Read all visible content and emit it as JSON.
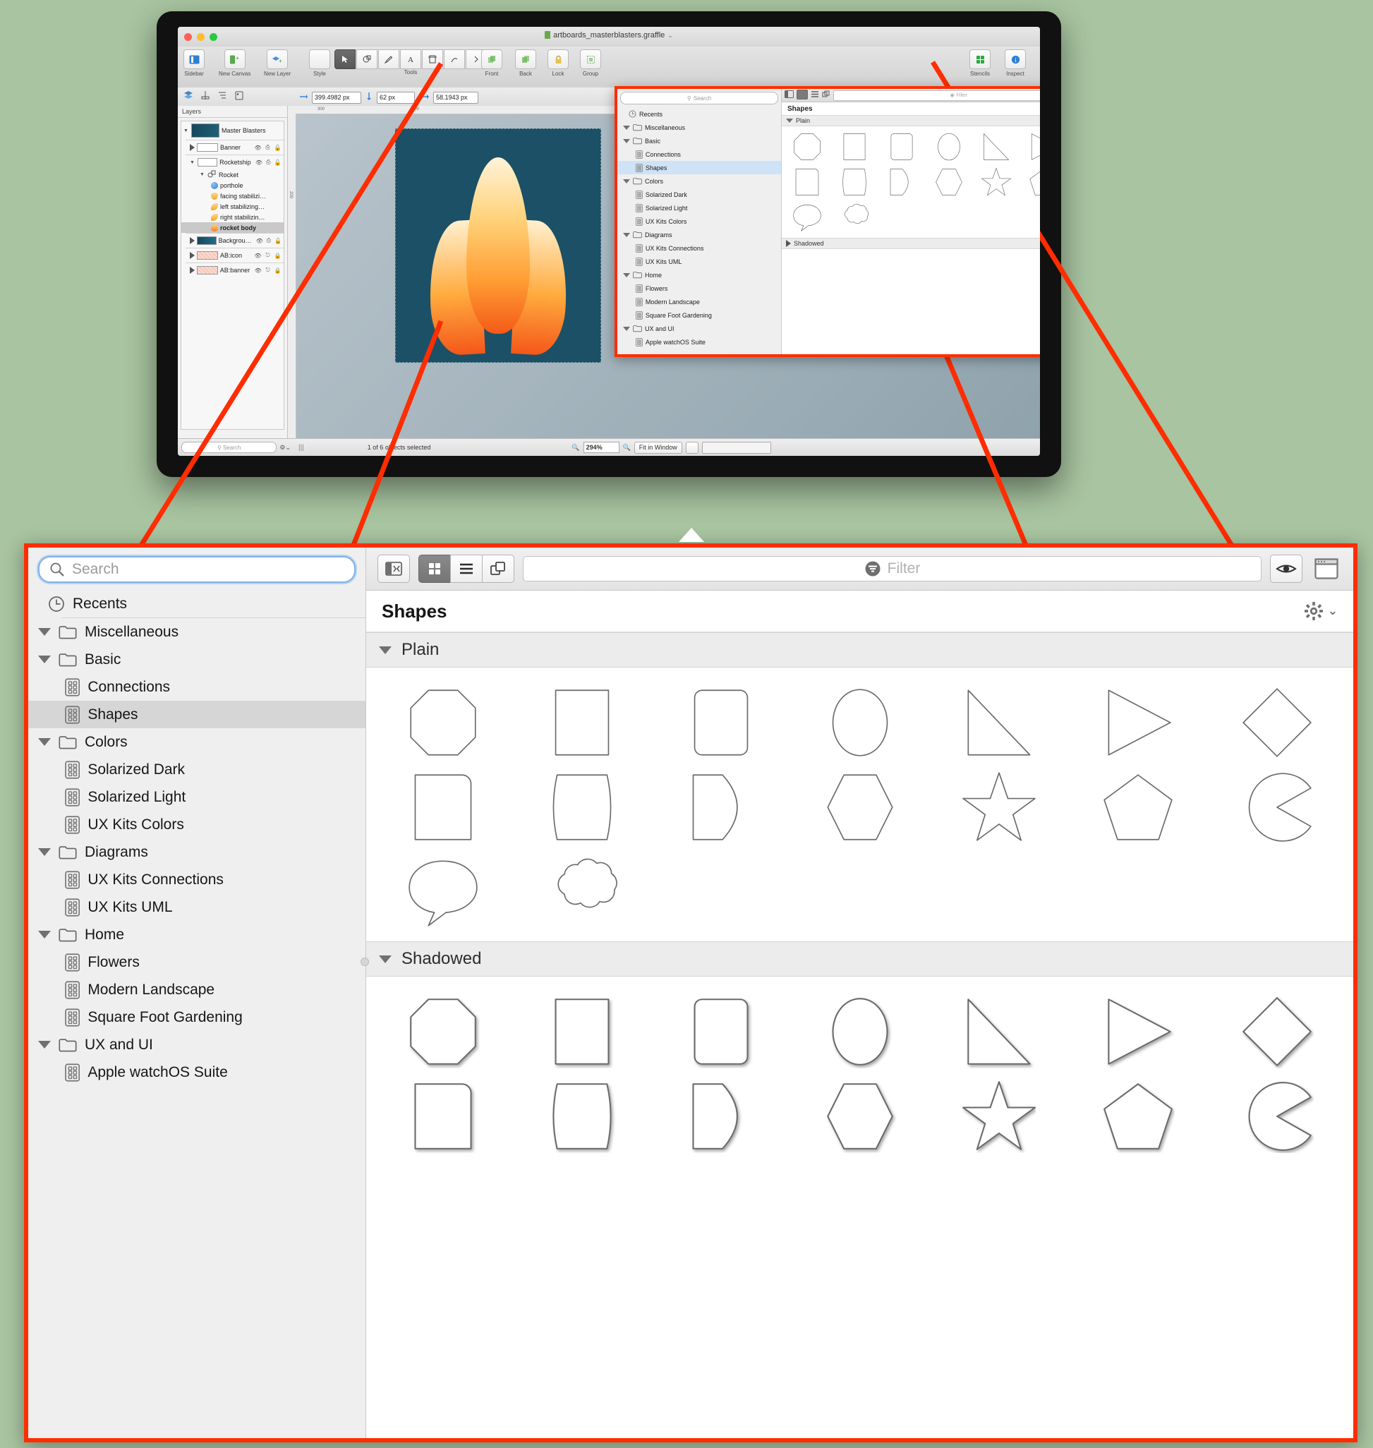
{
  "window": {
    "title": "artboards_masterblasters.graffle",
    "doc_icon": "document-icon",
    "caret": "⌄"
  },
  "toolbar": {
    "groups": [
      {
        "label": "Sidebar",
        "icon": "sidebar-icon"
      },
      {
        "label": "New Canvas",
        "icon": "new-canvas-icon"
      },
      {
        "label": "New Layer",
        "icon": "new-layer-icon"
      },
      {
        "label": "Style",
        "icon": "style-icon"
      },
      {
        "label": "Tools",
        "icon": "tools-icon"
      }
    ],
    "right_labels": [
      "Front",
      "Back",
      "Lock",
      "Group"
    ],
    "stencils_label": "Stencils",
    "inspect_label": "Inspect"
  },
  "geometry_bar": {
    "x_value": "399.4982 px",
    "y_value": "62 px",
    "w_value": "58.1943 px"
  },
  "layers": {
    "header": "Layers",
    "rows": [
      {
        "label": "Master Blasters",
        "type": "canvas",
        "indent": 0,
        "disclosure": "down",
        "thumb": "canvas-thumb"
      },
      {
        "label": "Banner",
        "type": "layer",
        "indent": 1,
        "disclosure": "right",
        "eye": "◉",
        "print": "⎙",
        "lock": "⚿"
      },
      {
        "label": "Rocketship",
        "type": "layer",
        "indent": 1,
        "disclosure": "down",
        "eye": "◉",
        "print": "⎙",
        "lock": "⚿"
      },
      {
        "label": "Rocket",
        "type": "group",
        "indent": 2,
        "disclosure": "down"
      },
      {
        "label": "porthole",
        "type": "object",
        "indent": 3,
        "color": "#3f8fd8"
      },
      {
        "label": "facing stabilizi…",
        "type": "object",
        "indent": 3,
        "color": "#f5b33c"
      },
      {
        "label": "left stabilizing…",
        "type": "object",
        "indent": 3,
        "color": "#f5a83c"
      },
      {
        "label": "right stabilizin…",
        "type": "object",
        "indent": 3,
        "color": "#f5a83c"
      },
      {
        "label": "rocket body",
        "type": "object",
        "indent": 3,
        "color": "#f79a2e",
        "selected": true
      },
      {
        "label": "Backgrou…",
        "type": "layer",
        "indent": 1,
        "disclosure": "right",
        "eye": "◉",
        "print": "⎙",
        "lock": "⚿"
      },
      {
        "label": "AB:icon",
        "type": "layer",
        "indent": 1,
        "disclosure": "right",
        "eye": "◉",
        "print": "⌧",
        "lock": "🔒"
      },
      {
        "label": "AB:banner",
        "type": "layer",
        "indent": 1,
        "disclosure": "right",
        "eye": "◉",
        "print": "⌧",
        "lock": "🔒"
      }
    ],
    "footer_search_placeholder": "Search",
    "gear_icon": "gear-icon"
  },
  "status_bar": {
    "selection": "1 of 6 objects selected",
    "zoom_value": "294%",
    "fit_label": "Fit in Window",
    "zoom_out_icon": "zoom-out-icon",
    "zoom_in_icon": "zoom-in-icon"
  },
  "ruler": {
    "marks": [
      "300",
      "400",
      "200"
    ]
  },
  "stencil_browser": {
    "search_placeholder": "Search",
    "search_icon": "search-icon",
    "filter_placeholder": "Filter",
    "filter_icon": "filter-icon",
    "sidebar_toggle_icon": "sidebar-toggle-icon",
    "grid_view_icon": "grid-view-icon",
    "list_view_icon": "list-view-icon",
    "stack_view_icon": "stack-view-icon",
    "preview_icon": "eye-icon",
    "window_icon": "window-panel-icon",
    "gear_icon": "gear-icon",
    "gear_caret": "⌄",
    "title": "Shapes",
    "sidebar": [
      {
        "label": "Recents",
        "icon": "clock-icon",
        "kind": "recents",
        "indent": 0
      },
      {
        "label": "Miscellaneous",
        "icon": "folder-icon",
        "kind": "folder",
        "indent": 0,
        "expanded": true
      },
      {
        "label": "Basic",
        "icon": "folder-icon",
        "kind": "folder",
        "indent": 0,
        "expanded": true
      },
      {
        "label": "Connections",
        "icon": "stencil-icon",
        "kind": "stencil",
        "indent": 1
      },
      {
        "label": "Shapes",
        "icon": "stencil-icon",
        "kind": "stencil",
        "indent": 1,
        "selected": true
      },
      {
        "label": "Colors",
        "icon": "folder-icon",
        "kind": "folder",
        "indent": 0,
        "expanded": true
      },
      {
        "label": "Solarized Dark",
        "icon": "stencil-icon",
        "kind": "stencil",
        "indent": 1
      },
      {
        "label": "Solarized Light",
        "icon": "stencil-icon",
        "kind": "stencil",
        "indent": 1
      },
      {
        "label": "UX Kits Colors",
        "icon": "stencil-icon",
        "kind": "stencil",
        "indent": 1
      },
      {
        "label": "Diagrams",
        "icon": "folder-icon",
        "kind": "folder",
        "indent": 0,
        "expanded": true
      },
      {
        "label": "UX Kits Connections",
        "icon": "stencil-icon",
        "kind": "stencil",
        "indent": 1
      },
      {
        "label": "UX Kits UML",
        "icon": "stencil-icon",
        "kind": "stencil",
        "indent": 1
      },
      {
        "label": "Home",
        "icon": "folder-icon",
        "kind": "folder",
        "indent": 0,
        "expanded": true
      },
      {
        "label": "Flowers",
        "icon": "stencil-icon",
        "kind": "stencil",
        "indent": 1
      },
      {
        "label": "Modern Landscape",
        "icon": "stencil-icon",
        "kind": "stencil",
        "indent": 1
      },
      {
        "label": "Square Foot Gardening",
        "icon": "stencil-icon",
        "kind": "stencil",
        "indent": 1
      },
      {
        "label": "UX and UI",
        "icon": "folder-icon",
        "kind": "folder",
        "indent": 0,
        "expanded": true
      },
      {
        "label": "Apple watchOS Suite",
        "icon": "stencil-icon",
        "kind": "stencil",
        "indent": 1
      }
    ],
    "sections": [
      {
        "label": "Plain",
        "expanded": true,
        "shapes": [
          "octagon",
          "rectangle",
          "rounded-rectangle",
          "ellipse",
          "right-triangle",
          "triangle",
          "diamond",
          "single-rounded-corner-square",
          "barrel",
          "d-shape",
          "hexagon",
          "star",
          "pentagon",
          "pac-man",
          "speech-bubble",
          "cloud-bubble"
        ]
      },
      {
        "label": "Shadowed",
        "expanded": true,
        "shapes": [
          "octagon",
          "rectangle",
          "rounded-rectangle",
          "ellipse",
          "right-triangle",
          "triangle",
          "diamond",
          "single-rounded-corner-square",
          "barrel",
          "d-shape",
          "hexagon",
          "star",
          "pentagon",
          "pac-man"
        ]
      }
    ]
  },
  "colors": {
    "callout": "#ff2d00",
    "selection_blue": "#cfe3f7",
    "focus_ring": "#7fb2e8",
    "page_background": "#a8c4a0"
  }
}
